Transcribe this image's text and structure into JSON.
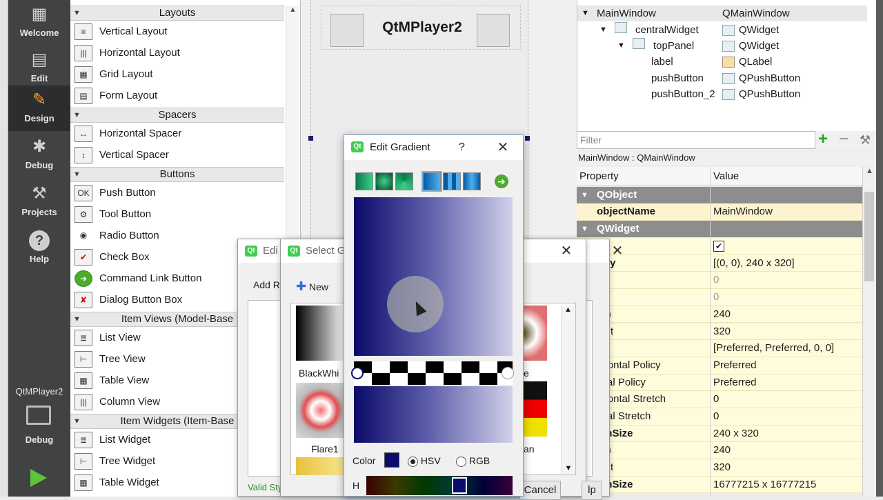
{
  "modebar": {
    "modes": [
      {
        "label": "Welcome",
        "icon": "grid-icon"
      },
      {
        "label": "Edit",
        "icon": "document-icon"
      },
      {
        "label": "Design",
        "icon": "pencil-icon"
      },
      {
        "label": "Debug",
        "icon": "bug-icon"
      },
      {
        "label": "Projects",
        "icon": "wrench-icon"
      },
      {
        "label": "Help",
        "icon": "help-icon"
      }
    ],
    "project": "QtMPlayer2",
    "target_label": "Debug"
  },
  "widgetbox": {
    "categories": {
      "layouts": "Layouts",
      "spacers": "Spacers",
      "buttons": "Buttons",
      "item_views": "Item Views (Model-Base",
      "item_widgets": "Item Widgets (Item-Base"
    },
    "items": [
      "Vertical Layout",
      "Horizontal Layout",
      "Grid Layout",
      "Form Layout",
      "Horizontal Spacer",
      "Vertical Spacer",
      "Push Button",
      "Tool Button",
      "Radio Button",
      "Check Box",
      "Command Link Button",
      "Dialog Button Box",
      "List View",
      "Tree View",
      "Table View",
      "Column View",
      "List Widget",
      "Tree Widget",
      "Table Widget"
    ]
  },
  "form": {
    "title_label": "QtMPlayer2"
  },
  "object_inspector": {
    "rows": [
      {
        "object": "MainWindow",
        "class": "QMainWindow"
      },
      {
        "object": "centralWidget",
        "class": "QWidget"
      },
      {
        "object": "topPanel",
        "class": "QWidget"
      },
      {
        "object": "label",
        "class": "QLabel"
      },
      {
        "object": "pushButton",
        "class": "QPushButton"
      },
      {
        "object": "pushButton_2",
        "class": "QPushButton"
      }
    ]
  },
  "property_editor": {
    "filter_placeholder": "Filter",
    "caption": "MainWindow : QMainWindow",
    "header_property": "Property",
    "header_value": "Value",
    "group_qobject": "QObject",
    "group_qwidget": "QWidget",
    "object_name_label": "objectName",
    "object_name_value": "MainWindow",
    "rows": [
      {
        "name": "d",
        "value": ""
      },
      {
        "name": "etry",
        "value": "[(0, 0), 240 x 320]"
      },
      {
        "name": "",
        "value": "0"
      },
      {
        "name": "",
        "value": "0"
      },
      {
        "name": "dth",
        "value": "240"
      },
      {
        "name": "ight",
        "value": "320"
      },
      {
        "name": "icy",
        "value": "[Preferred, Preferred, 0, 0]"
      },
      {
        "name": "rizontal Policy",
        "value": "Preferred"
      },
      {
        "name": "tical Policy",
        "value": "Preferred"
      },
      {
        "name": "rizontal Stretch",
        "value": "0"
      },
      {
        "name": "tical Stretch",
        "value": "0"
      },
      {
        "name": "umSize",
        "value": "240 x 320"
      },
      {
        "name": "dth",
        "value": "240"
      },
      {
        "name": "ight",
        "value": "320"
      },
      {
        "name": "umSize",
        "value": "16777215 x 16777215"
      }
    ]
  },
  "dialogs": {
    "edit_stylesheet": {
      "title": "Edi",
      "add_resource": "Add R",
      "valid": "Valid Sty"
    },
    "select_gradient": {
      "title": "Select G",
      "new_button": "New",
      "preset1": "BlackWhi",
      "preset2": "Flare1",
      "preset3": "e",
      "preset4": "an",
      "cancel": "Cancel",
      "help": "lp"
    },
    "edit_gradient": {
      "title": "Edit Gradient",
      "help_glyph": "?",
      "color_label": "Color",
      "hsv_label": "HSV",
      "rgb_label": "RGB",
      "h_label": "H",
      "color_swatch": "#0c0c6e"
    }
  }
}
